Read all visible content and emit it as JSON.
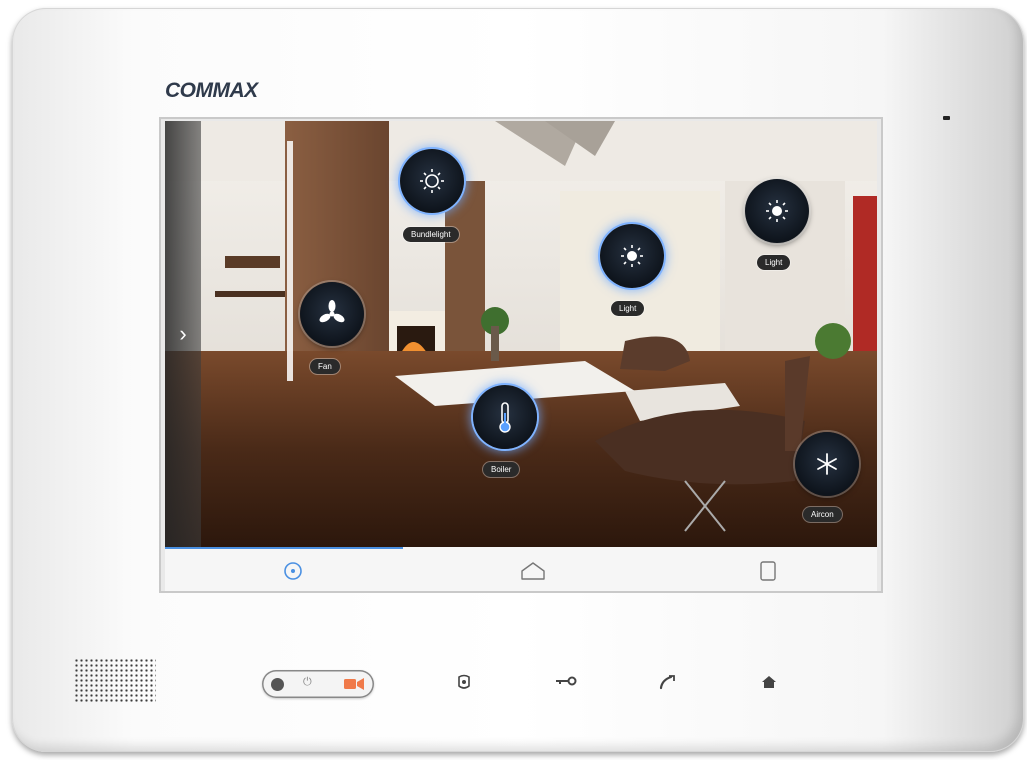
{
  "brand": {
    "name": "COMMAX"
  },
  "screen": {
    "side_arrow": "›",
    "devices": [
      {
        "label": "Bundlelight",
        "icon": "sun-icon",
        "active": true
      },
      {
        "label": "Light",
        "icon": "sun-icon",
        "active": true
      },
      {
        "label": "Light",
        "icon": "sun-icon",
        "active": false
      },
      {
        "label": "Fan",
        "icon": "fan-icon",
        "active": false
      },
      {
        "label": "Boiler",
        "icon": "thermometer-icon",
        "active": true
      },
      {
        "label": "Aircon",
        "icon": "snowflake-icon",
        "active": false
      }
    ],
    "nav": [
      {
        "icon": "clock-icon",
        "active": true
      },
      {
        "icon": "home-icon",
        "active": false
      },
      {
        "icon": "square-icon",
        "active": false
      }
    ]
  },
  "hardware": {
    "toggle": {
      "power_icon": "⏻"
    },
    "buttons": [
      "camera-icon",
      "key-icon",
      "phone-icon",
      "home-icon"
    ]
  },
  "colors": {
    "accent": "#4a90e2",
    "active_glow": "#7fb3ff",
    "record": "#f07a4a"
  }
}
